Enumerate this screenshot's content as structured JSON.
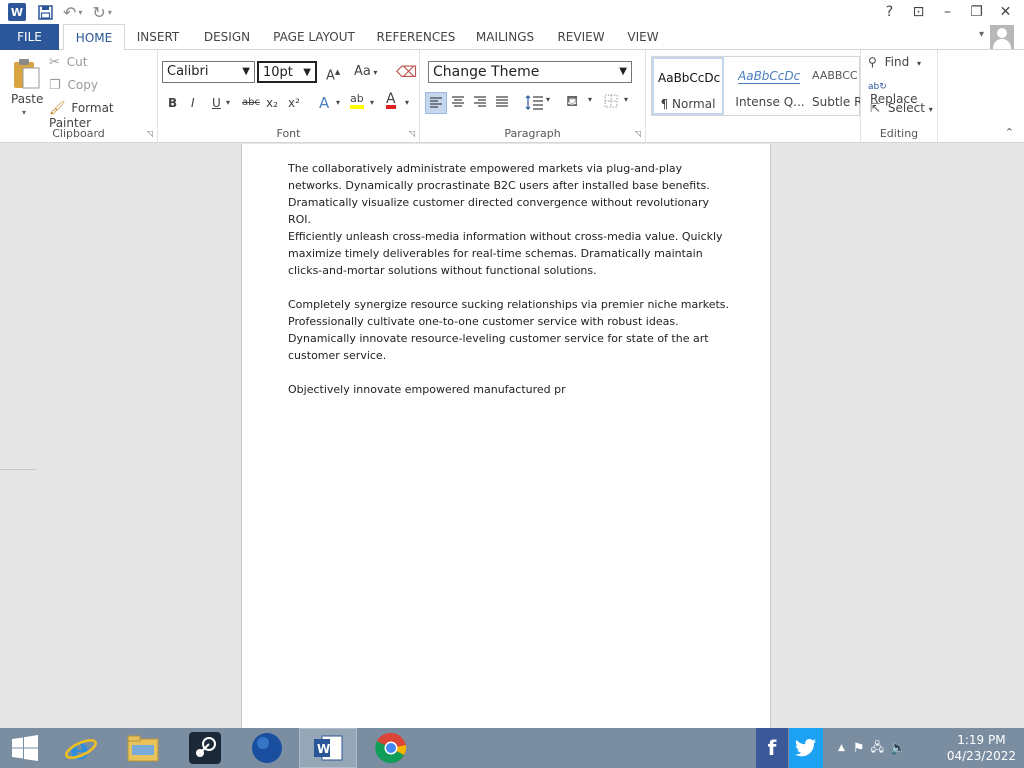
{
  "titlebar": {
    "app_logo": "W",
    "help": "?",
    "ribbon_display": "⊡",
    "minimize": "–",
    "restore": "❐",
    "close": "✕"
  },
  "tabs": [
    "FILE",
    "HOME",
    "INSERT",
    "DESIGN",
    "PAGE LAYOUT",
    "REFERENCES",
    "MAILINGS",
    "REVIEW",
    "VIEW"
  ],
  "clipboard": {
    "paste": "Paste",
    "cut": "Cut",
    "copy": "Copy",
    "format_painter": "Format Painter",
    "label": "Clipboard"
  },
  "font": {
    "family": "Calibri",
    "size": "10pt",
    "label": "Font",
    "bold": "B",
    "italic": "I",
    "underline": "U",
    "strikethrough": "abc",
    "subscript": "x₂",
    "superscript": "x²",
    "grow": "A",
    "change_case": "Aa",
    "effects": "A",
    "highlight": "ab",
    "color": "A"
  },
  "paragraph": {
    "theme": "Change Theme",
    "label": "Paragraph"
  },
  "styles": [
    {
      "sample": "AaBbCcDc",
      "name": "¶ Normal"
    },
    {
      "sample": "AaBbCcDc",
      "name": "Intense Q..."
    },
    {
      "sample": "AABBCC",
      "name": "Subtle Re"
    }
  ],
  "editing": {
    "find": "Find",
    "replace": "Replace",
    "select": "Select",
    "label": "Editing"
  },
  "document": {
    "paragraphs": [
      "The collaboratively administrate empowered markets via plug-and-play networks. Dynamically procrastinate B2C users after installed base benefits. Dramatically visualize customer directed convergence without revolutionary ROI.",
      "Efficiently unleash cross-media information without cross-media value. Quickly maximize timely deliverables for real-time schemas. Dramatically maintain clicks-and-mortar solutions without functional solutions.",
      "Completely synergize resource sucking relationships via premier niche markets. Professionally cultivate one-to-one customer service with robust ideas. Dynamically innovate resource-leveling customer service for state of the art customer service.",
      "Objectively innovate empowered manufactured pr"
    ]
  },
  "taskbar": {
    "time": "1:19 PM",
    "date": "04/23/2022"
  },
  "colors": {
    "accent": "#2b579a",
    "taskbar": "#7a8da1",
    "highlight_yellow": "#ffff00",
    "font_red": "#e02020"
  }
}
